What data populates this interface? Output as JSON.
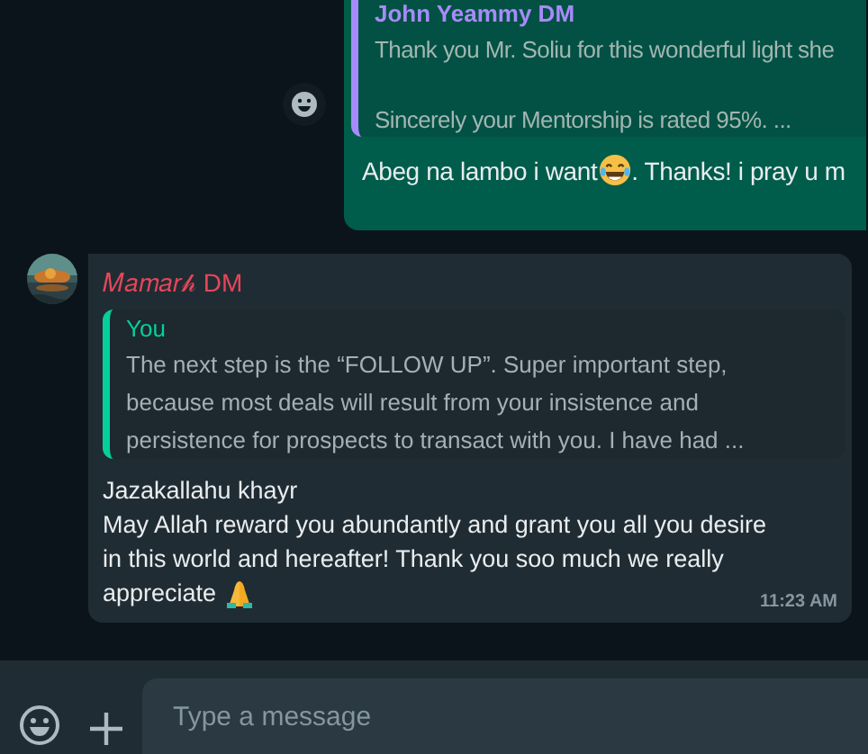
{
  "outgoing_message": {
    "quote": {
      "sender": "John Yeammy DM",
      "text": "Thank you Mr. Soliu for this wonderful light she\n\nSincerely your Mentorship is rated 95%. ..."
    },
    "text_before_emoji": "Abeg na lambo i want",
    "text_after_emoji": ". Thanks! i pray u m"
  },
  "incoming_message": {
    "sender": "𝑀𝑎𝑚𝑎𝑟𝒽 DM",
    "quote": {
      "sender": "You",
      "text": "The next step is the “FOLLOW UP”. Super important step, because most deals will result from your insistence and persistence for prospects to transact with you. I have had ..."
    },
    "greeting": "Jazakallahu khayr",
    "body": "May Allah reward you abundantly and grant you all you desire in this world and hereafter! Thank you soo much we really",
    "body_last_word": "appreciate",
    "time": "11:23 AM"
  },
  "composer": {
    "placeholder": "Type a message"
  }
}
